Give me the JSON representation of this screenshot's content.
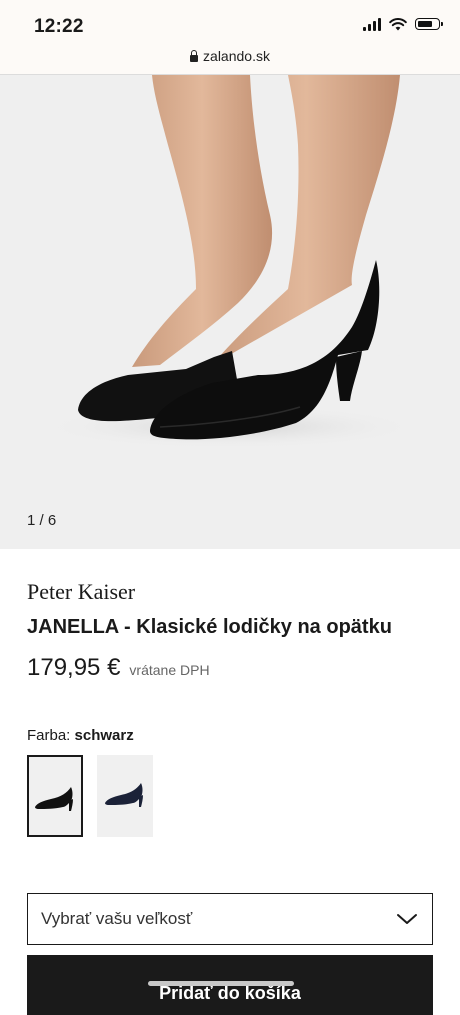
{
  "status_bar": {
    "time": "12:22",
    "url": "zalando.sk"
  },
  "hero": {
    "image_subject": "black suede pointed-toe kitten heel pumps",
    "counter": "1 / 6"
  },
  "product": {
    "brand": "Peter Kaiser",
    "name": "JANELLA - Klasické lodičky na opätku",
    "price": "179,95 €",
    "vat_note": "vrátane DPH"
  },
  "color": {
    "label": "Farba:",
    "selected": "schwarz",
    "swatches": [
      {
        "name": "schwarz",
        "color": "#111111",
        "selected": true
      },
      {
        "name": "navy",
        "color": "#1b2238",
        "selected": false
      }
    ]
  },
  "size_select": {
    "placeholder": "Vybrať vašu veľkosť"
  },
  "cta": {
    "label": "Pridať do košíka"
  },
  "colors": {
    "primary": "#1a1a1a",
    "muted_text": "#666666",
    "image_bg": "#efefef"
  },
  "icons": [
    "signal-icon",
    "wifi-icon",
    "battery-icon",
    "lock-icon",
    "chevron-down-icon"
  ]
}
